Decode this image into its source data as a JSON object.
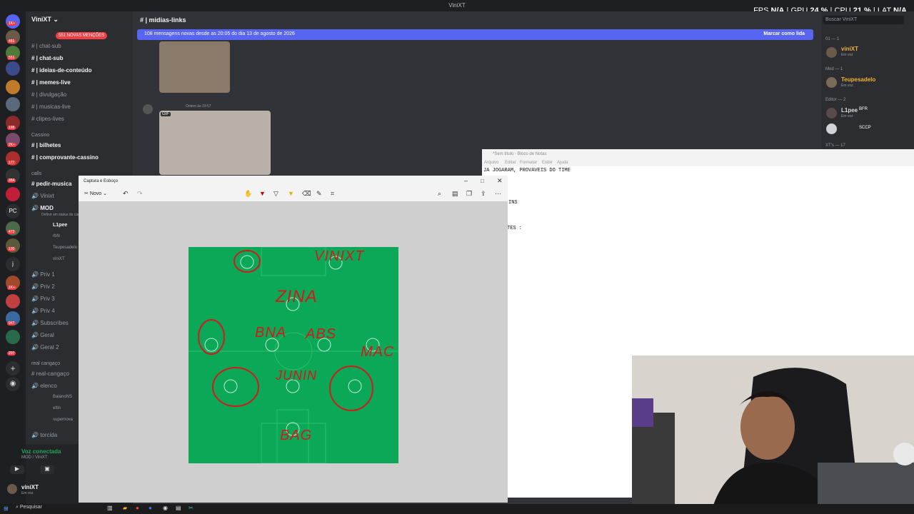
{
  "window": {
    "title": "ViniXT"
  },
  "perf": {
    "fps_label": "FPS",
    "fps": "N/A",
    "gpu_label": "GPU",
    "gpu": "24 %",
    "cpu_label": "CPU",
    "cpu": "21 %",
    "lat_label": "LAT",
    "lat": "N/A"
  },
  "server": {
    "name": "ViniXT",
    "mention_pill": "551 NOVAS MENÇÕES"
  },
  "rail_badges": [
    "1K+",
    "481",
    "551",
    "198",
    "2K+",
    "177",
    "384",
    "PC",
    "473",
    "130",
    "j",
    "1K+",
    "947",
    "207"
  ],
  "channels": [
    {
      "name": "| chat-sub",
      "dim": true
    },
    {
      "name": "| chat-sub",
      "dim": false
    },
    {
      "name": "| ideias-de-conteúdo",
      "dim": false
    },
    {
      "name": "| memes-live",
      "dim": false
    },
    {
      "name": "| divulgação",
      "dim": true
    },
    {
      "name": "| musicas-live",
      "dim": true
    },
    {
      "name": "clipes-lives",
      "dim": true
    }
  ],
  "cat_cassino": "Cassino",
  "cassino_channels": [
    "| bilhetes",
    "| comprovante-cassino"
  ],
  "cat_calls": "calls",
  "voice": [
    "pedir-musica",
    "Vinixt",
    "MOD"
  ],
  "mod_status": "Definir um status do canal",
  "voice_members": [
    "L1pee",
    "rbN",
    "Teupesadelo",
    "viniXT"
  ],
  "privs": [
    "Priv 1",
    "Priv 2",
    "Priv 3",
    "Priv 4",
    "Subscribes",
    "Geral",
    "Geral 2"
  ],
  "cat_real": "real cangaço",
  "real_channels": [
    "real-cangaço",
    "elenco"
  ],
  "elenco_members": [
    "BaianoNS",
    "eltin",
    "supernova"
  ],
  "torcida": "torcida",
  "voice_connected": "Voz conectada",
  "voice_channel": "MOD / ViniXT",
  "user": {
    "name": "viniXT",
    "status": "Em voz"
  },
  "chat": {
    "channel": "| midias-links",
    "banner": "108 mensagens novas desde as 20:05 do dia 13 de agosto de 2026",
    "mark_read": "Marcar como lida",
    "msg_time": "Ontem às 23:57",
    "gif_tag": "GIF"
  },
  "members": {
    "search": "Buscar ViniXT",
    "groups": [
      {
        "label": "01 — 1",
        "name": "viniXT",
        "sub": "Em voz",
        "color": "#f0b232"
      },
      {
        "label": "Mod — 1",
        "name": "Teupesadelo",
        "sub": "Em voz",
        "color": "#f0b232"
      },
      {
        "label": "Editor — 2",
        "name": "L1pee",
        "sub": "Em voz",
        "color": "#dbdee1"
      }
    ],
    "tag_bfr": "BFR",
    "tag_sccp": "SCCP",
    "more": "XT's — 17"
  },
  "notepad": {
    "title": "*Sem título - Bloco de Notas",
    "menu": [
      "Arquivo",
      "Editar",
      "Formatar",
      "Exibir",
      "Ajuda"
    ],
    "line1": "JA JOGARAM, PROVAVEIS DO TIME",
    "line2": "INS",
    "line3": "TES :"
  },
  "snip": {
    "title": "Captura e Esboço",
    "new_label": "Novo"
  },
  "field_annotations": {
    "top_right": "VINIXT",
    "striker": "ZINA",
    "cm_left": "BNA",
    "cm_right": "ABS",
    "winger_right": "MAC",
    "dm": "JUNIN",
    "gk": "BAG"
  },
  "taskbar": {
    "search": "Pesquisar"
  },
  "colors": {
    "blurple": "#5865f2",
    "pitch": "#0aa857",
    "ink": "#d21a1a",
    "mention": "#f23f43"
  }
}
